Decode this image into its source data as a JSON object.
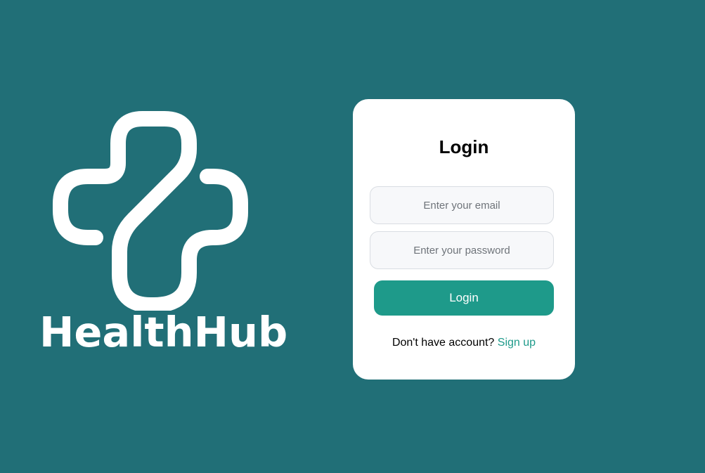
{
  "brand": {
    "name": "HealthHub",
    "logo_icon": "medical-cross-logo-icon",
    "logo_color": "#ffffff"
  },
  "colors": {
    "background": "#216f77",
    "card": "#ffffff",
    "accent": "#1e9a8a",
    "input_background": "#f7f8fa"
  },
  "login_card": {
    "title": "Login",
    "email": {
      "value": "",
      "placeholder": "Enter your email"
    },
    "password": {
      "value": "",
      "placeholder": "Enter your password"
    },
    "submit_label": "Login",
    "signup_prompt": "Don't have account?",
    "signup_link_label": "Sign up"
  }
}
